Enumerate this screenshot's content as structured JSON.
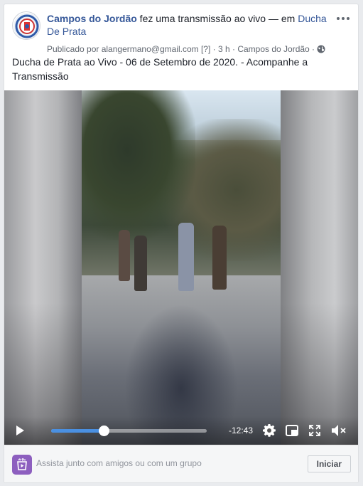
{
  "post": {
    "page_name": "Campos do Jordão",
    "action_text": " fez uma transmissão ao vivo — em ",
    "location": "Ducha De Prata",
    "published_by_label": "Publicado por ",
    "published_by": "alangermano@gmail.com",
    "help_marker": " [?] ",
    "time_ago": "· 3 h ·",
    "place": " Campos do Jordão ·",
    "privacy_icon": "globe-icon",
    "caption": "Ducha de Prata ao Vivo - 06 de Setembro de 2020. - Acompanhe a Transmissão"
  },
  "video": {
    "progress_fraction": 0.34,
    "remaining_time": "-12:43",
    "accent_color": "#4a90e2",
    "icons": [
      "play-icon",
      "gear-icon",
      "pip-icon",
      "fullscreen-icon",
      "volume-muted-icon"
    ]
  },
  "watch_party": {
    "prompt": "Assista junto com amigos ou com um grupo",
    "button_label": "Iniciar",
    "icon": "watch-party-icon",
    "icon_color": "#8d5fbf"
  }
}
